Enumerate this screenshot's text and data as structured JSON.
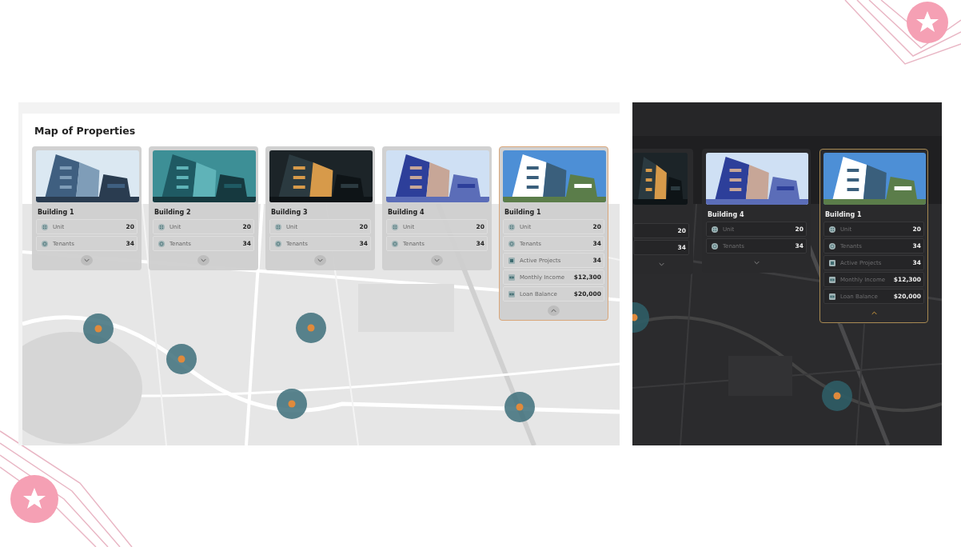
{
  "light_view": {
    "title": "Map of Properties",
    "cards": [
      {
        "title": "Building 1",
        "selected": false,
        "expanded": false,
        "stats": [
          {
            "kind": "unit",
            "label": "Unit",
            "value": "20"
          },
          {
            "kind": "tenants",
            "label": "Tenants",
            "value": "34"
          }
        ]
      },
      {
        "title": "Building 2",
        "selected": false,
        "expanded": false,
        "stats": [
          {
            "kind": "unit",
            "label": "Unit",
            "value": "20"
          },
          {
            "kind": "tenants",
            "label": "Tenants",
            "value": "34"
          }
        ]
      },
      {
        "title": "Building 3",
        "selected": false,
        "expanded": false,
        "stats": [
          {
            "kind": "unit",
            "label": "Unit",
            "value": "20"
          },
          {
            "kind": "tenants",
            "label": "Tenants",
            "value": "34"
          }
        ]
      },
      {
        "title": "Building 4",
        "selected": false,
        "expanded": false,
        "stats": [
          {
            "kind": "unit",
            "label": "Unit",
            "value": "20"
          },
          {
            "kind": "tenants",
            "label": "Tenants",
            "value": "34"
          }
        ]
      },
      {
        "title": "Building 1",
        "selected": true,
        "expanded": true,
        "stats": [
          {
            "kind": "unit",
            "label": "Unit",
            "value": "20"
          },
          {
            "kind": "tenants",
            "label": "Tenants",
            "value": "34"
          },
          {
            "kind": "projects",
            "label": "Active Projects",
            "value": "34"
          },
          {
            "kind": "income",
            "label": "Monthly Income",
            "value": "$12,300"
          },
          {
            "kind": "balance",
            "label": "Loan Balance",
            "value": "$20,000"
          }
        ]
      }
    ]
  },
  "dark_view": {
    "cards": [
      {
        "selected": false,
        "expanded": false,
        "stats": [
          {
            "value": "20"
          },
          {
            "value": "34"
          }
        ]
      },
      {
        "title": "Building 4",
        "selected": false,
        "expanded": false,
        "stats": [
          {
            "kind": "unit",
            "label": "Unit",
            "value": "20"
          },
          {
            "kind": "tenants",
            "label": "Tenants",
            "value": "34"
          }
        ]
      },
      {
        "title": "Building 1",
        "selected": true,
        "expanded": true,
        "stats": [
          {
            "kind": "unit",
            "label": "Unit",
            "value": "20"
          },
          {
            "kind": "tenants",
            "label": "Tenants",
            "value": "34"
          },
          {
            "kind": "projects",
            "label": "Active Projects",
            "value": "34"
          },
          {
            "kind": "income",
            "label": "Monthly Income",
            "value": "$12,300"
          },
          {
            "kind": "balance",
            "label": "Loan Balance",
            "value": "$20,000"
          }
        ]
      }
    ]
  }
}
